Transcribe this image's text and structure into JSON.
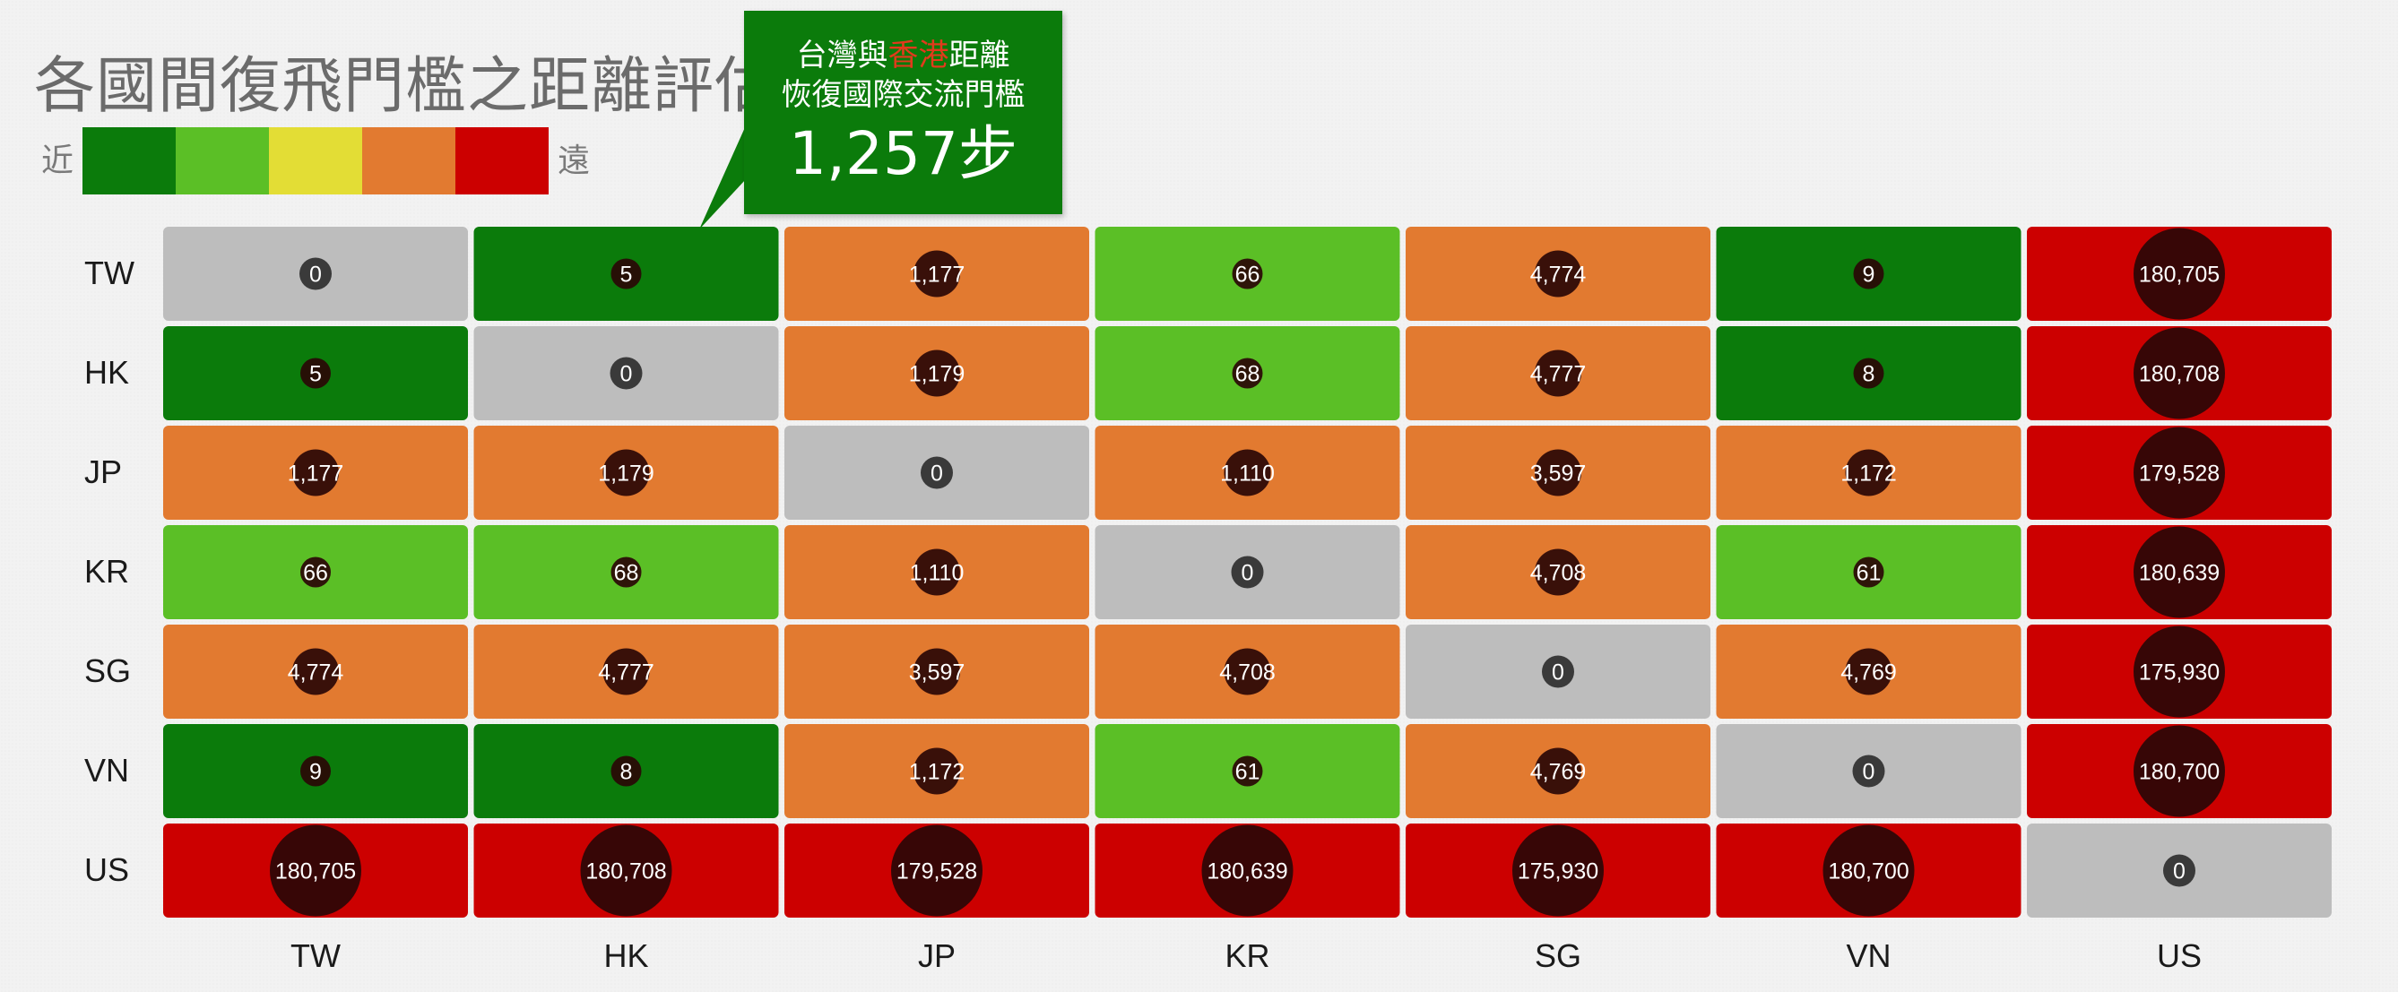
{
  "title": "各國間復飛門檻之距離評估",
  "legend": {
    "near_label": "近",
    "far_label": "遠",
    "colors": [
      "#0b7b0b",
      "#5bbf26",
      "#e3dd35",
      "#e27a30",
      "#cc0000"
    ]
  },
  "callout": {
    "line1_pre": "台灣與",
    "line1_highlight": "香港",
    "line1_post": "距離",
    "line2": "恢復國際交流門檻",
    "value": "1,257步"
  },
  "chart_data": {
    "type": "heatmap",
    "rows": [
      "TW",
      "HK",
      "JP",
      "KR",
      "SG",
      "VN",
      "US"
    ],
    "columns": [
      "TW",
      "HK",
      "JP",
      "KR",
      "SG",
      "VN",
      "US"
    ],
    "values": [
      [
        0,
        5,
        1177,
        66,
        4774,
        9,
        180705
      ],
      [
        5,
        0,
        1179,
        68,
        4777,
        8,
        180708
      ],
      [
        1177,
        1179,
        0,
        1110,
        3597,
        1172,
        179528
      ],
      [
        66,
        68,
        1110,
        0,
        4708,
        61,
        180639
      ],
      [
        4774,
        4777,
        3597,
        4708,
        0,
        4769,
        175930
      ],
      [
        9,
        8,
        1172,
        61,
        4769,
        0,
        180700
      ],
      [
        180705,
        180708,
        179528,
        180639,
        175930,
        180700,
        0
      ]
    ],
    "color_bins": [
      {
        "max": 0,
        "color": "#bdbdbd"
      },
      {
        "max": 30,
        "color": "#0b7b0b"
      },
      {
        "max": 500,
        "color": "#5bbf26"
      },
      {
        "max": 100000,
        "color": "#e27a30"
      },
      {
        "max": 1000000,
        "color": "#cc0000"
      }
    ],
    "bubble_color": "#2a0707",
    "zero_bubble_color": "#3a3a3a"
  }
}
